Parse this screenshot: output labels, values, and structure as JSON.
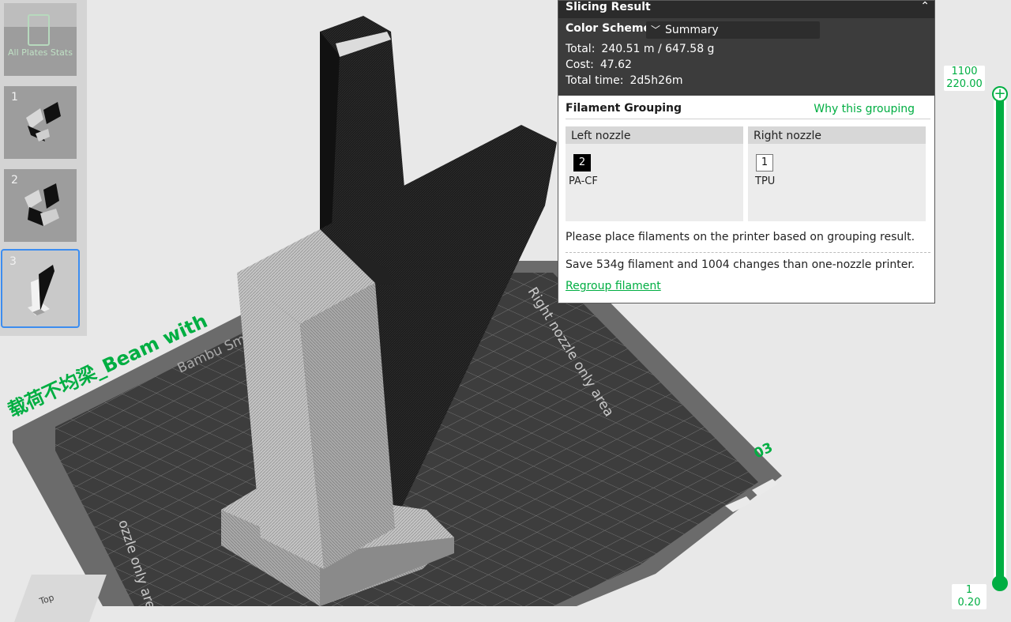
{
  "plates": {
    "all_plates_label": "All Plates Stats",
    "items": [
      {
        "number": "1"
      },
      {
        "number": "2"
      },
      {
        "number": "3"
      }
    ]
  },
  "viewport": {
    "plate_name": "载荷不均梁_Beam with",
    "bed_brand": "Bambu Sm",
    "right_zone_label": "Right nozzle only area",
    "left_zone_label": "ozzle only area",
    "plate_number": "03",
    "view_cube_label": "Top"
  },
  "slicing_result": {
    "title": "Slicing Result",
    "color_scheme_label": "Color Scheme",
    "color_scheme_value": "Summary",
    "stats": [
      {
        "key": "Total:",
        "value": "240.51 m / 647.58 g"
      },
      {
        "key": "Cost:",
        "value": "47.62"
      },
      {
        "key": "Total time:",
        "value": "2d5h26m"
      }
    ],
    "filament_grouping_label": "Filament Grouping",
    "why_grouping_link": "Why this grouping",
    "left_nozzle": {
      "label": "Left nozzle",
      "filament_id": "2",
      "filament_name": "PA-CF",
      "chip_color": "#000000"
    },
    "right_nozzle": {
      "label": "Right nozzle",
      "filament_id": "1",
      "filament_name": "TPU",
      "chip_color": "#ffffff"
    },
    "place_message": "Please place filaments on the printer based on grouping result.",
    "save_message": "Save 534g filament and 1004 changes than one-nozzle printer.",
    "regroup_link": "Regroup filament"
  },
  "layer_slider": {
    "top_layer": "1100",
    "top_height": "220.00",
    "bottom_layer": "1",
    "bottom_height": "0.20"
  },
  "colors": {
    "accent": "#00ae42",
    "panel_dark": "#3c3c3c",
    "selected_border": "#3c8df0"
  },
  "icons": {
    "collapse": "double-chevron-up-icon",
    "dropdown": "chevron-down-icon",
    "slider_top": "plus-icon"
  }
}
